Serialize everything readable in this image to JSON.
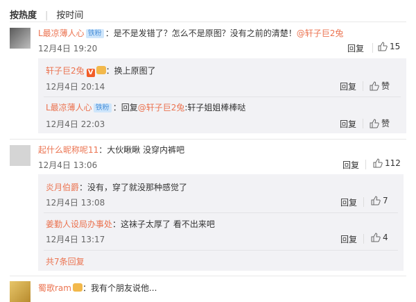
{
  "sort": {
    "hot": "按热度",
    "time": "按时间"
  },
  "c1": {
    "user": "L最凉薄人心",
    "badge": "铁粉",
    "text": "：是不是发错了？怎么不是原图？没有之前的清楚！",
    "mention": "@轩子巨2兔",
    "time": "12月4日 19:20",
    "reply": "回复",
    "likes": "15",
    "subs": [
      {
        "user": "轩子巨2兔",
        "text": "：换上原图了",
        "time": "12月4日 20:14",
        "reply": "回复",
        "likes": "赞"
      },
      {
        "user": "L最凉薄人心",
        "badge": "铁粉",
        "pre": "：回复",
        "mention": "@轩子巨2兔",
        "text": ":轩子姐姐棒棒哒",
        "time": "12月4日 22:03",
        "reply": "回复",
        "likes": "赞"
      }
    ]
  },
  "c2": {
    "user": "起什么昵称呢11",
    "text": "：大伙瞅瞅 没穿内裤吧",
    "time": "12月4日 13:06",
    "reply": "回复",
    "likes": "112",
    "subs": [
      {
        "user": "炎月伯爵",
        "text": "：没有，穿了就没那种感觉了",
        "time": "12月4日 13:08",
        "reply": "回复",
        "likes": "7"
      },
      {
        "user": "姜勤人设局办事处",
        "text": "：这袜子太厚了 看不出来吧",
        "time": "12月4日 13:17",
        "reply": "回复",
        "likes": "4"
      }
    ],
    "more": "共7条回复"
  },
  "c3": {
    "user": "蜀歌ram",
    "text": "：我有个朋友说他..."
  }
}
